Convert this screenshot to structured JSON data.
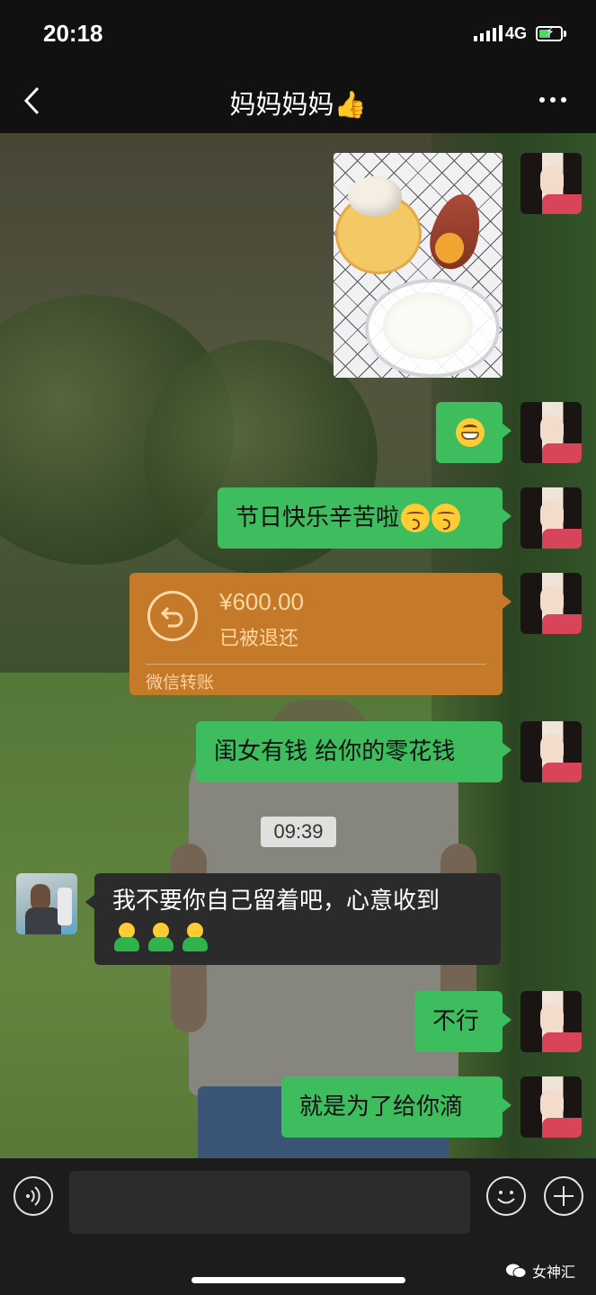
{
  "status_bar": {
    "time": "20:18",
    "network": "4G"
  },
  "nav": {
    "title": "妈妈妈妈👍"
  },
  "messages": {
    "m2_emoji": "grin",
    "m3_text": "节日快乐辛苦啦",
    "transfer": {
      "amount": "¥600.00",
      "status": "已被退还",
      "label": "微信转账"
    },
    "m5_text": "闺女有钱 给你的零花钱",
    "timestamp": "09:39",
    "m6_text": "我不要你自己留着吧，心意收到",
    "m7_text": "不行",
    "m8_text": "就是为了给你滴"
  },
  "watermark": {
    "text": "女神汇"
  },
  "colors": {
    "bubble_green": "#3dbd5d",
    "transfer_orange": "#c47a28",
    "received_bubble": "#2b2b2b"
  }
}
